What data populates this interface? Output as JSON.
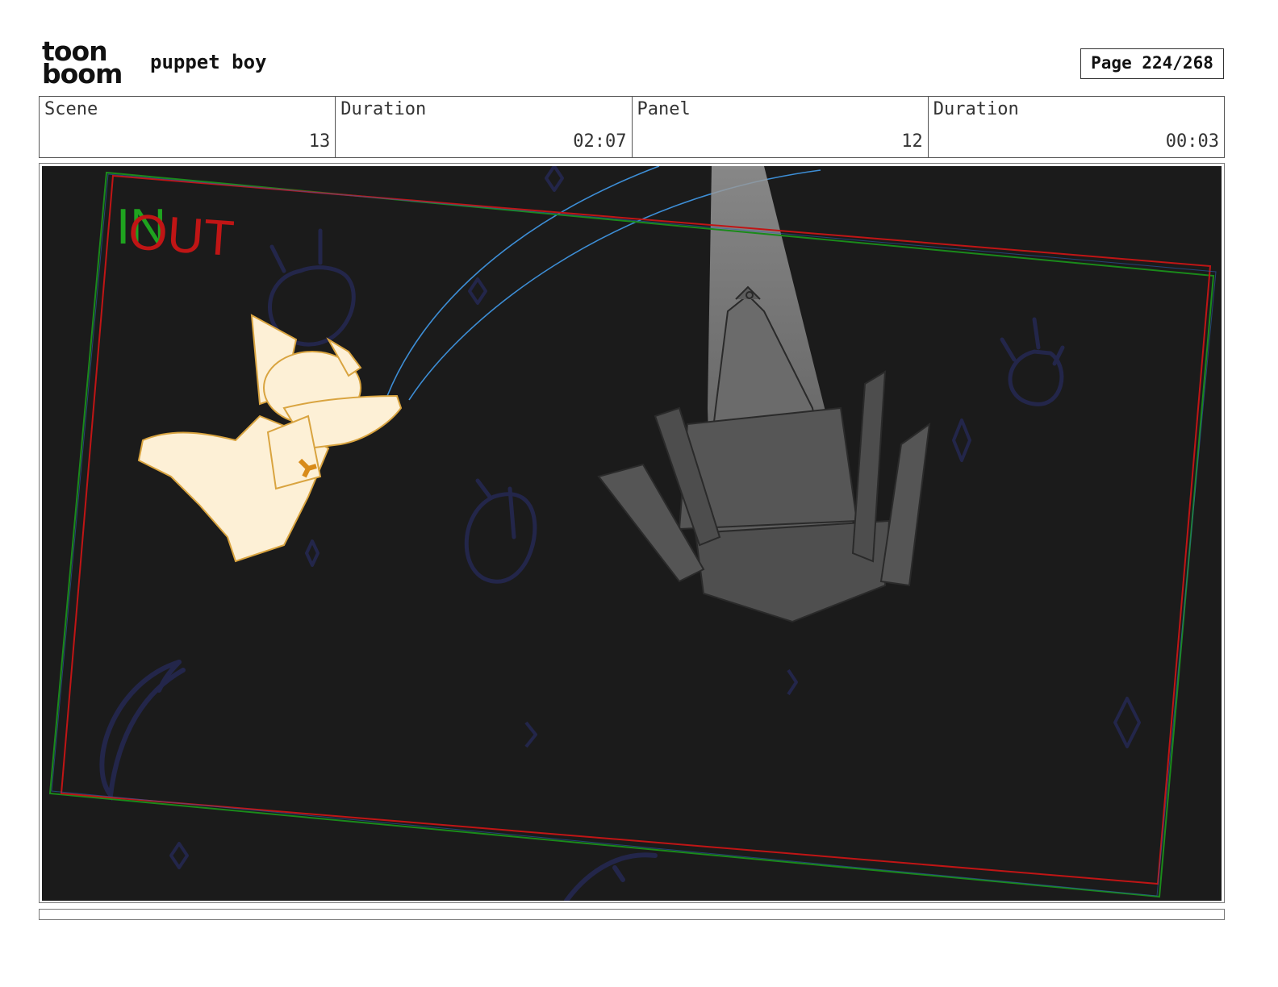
{
  "header": {
    "logo_line1": "toon",
    "logo_line2": "boom",
    "project_title": "puppet boy",
    "page_label": "Page 224/268"
  },
  "info": {
    "scene_label": "Scene",
    "scene_value": "13",
    "scene_duration_label": "Duration",
    "scene_duration_value": "02:07",
    "panel_label": "Panel",
    "panel_value": "12",
    "panel_duration_label": "Duration",
    "panel_duration_value": "00:03"
  },
  "frame_markers": {
    "in_label": "IN",
    "out_label": "OUT",
    "in_color": "#1fa31f",
    "out_color": "#c01515"
  },
  "colors": {
    "background": "#1b1b1b",
    "doodle": "#23264a",
    "string": "#3d8ed6",
    "character_fill": "#fdf0d6",
    "character_line": "#d9a440",
    "bow": "#d88b1a",
    "castle": "#5a5a5a"
  }
}
